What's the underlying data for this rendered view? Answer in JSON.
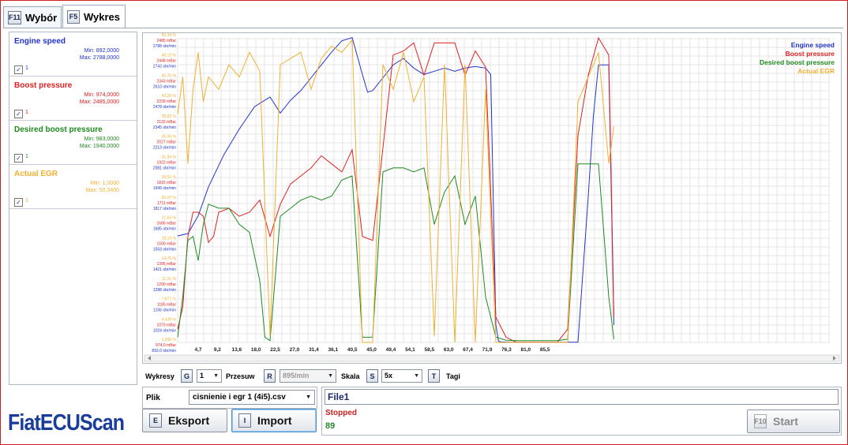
{
  "tabs": [
    {
      "key": "F11",
      "label": "Wybór"
    },
    {
      "key": "F5",
      "label": "Wykres"
    }
  ],
  "colors": {
    "engine": "#2233cc",
    "boost": "#e02020",
    "desired": "#1e8a1e",
    "egr": "#f0b030"
  },
  "legend": [
    {
      "name": "Engine speed",
      "min": "Min: 892,0000",
      "max": "Max: 2788,0000",
      "check": "✓",
      "value": "1"
    },
    {
      "name": "Boost pressure",
      "min": "Min: 974,0000",
      "max": "Max: 2485,0000",
      "check": "✓",
      "value": "1"
    },
    {
      "name": "Desired boost pressure",
      "min": "Min: 983,0000",
      "max": "Max: 1940,0000",
      "check": "✓",
      "value": "1"
    },
    {
      "name": "Actual EGR",
      "min": "Min: 1,0000",
      "max": "Max: 50,3400",
      "check": "✓",
      "value": "1"
    }
  ],
  "chart_data": {
    "type": "line",
    "x_ticks": [
      "4,7",
      "9,2",
      "13,6",
      "18,0",
      "22,5",
      "27,0",
      "31,4",
      "36,1",
      "40,5",
      "45,0",
      "49,4",
      "54,1",
      "58,5",
      "63,0",
      "67,4",
      "71,9",
      "76,3",
      "81,0",
      "85,5"
    ],
    "y_tick_labels": [
      [
        "50,34 %",
        "2485 mBar",
        "2788 obr/min"
      ],
      [
        "48,13 %",
        "2448 mBar",
        "2742 obr/min"
      ],
      [
        "45,70 %",
        "2343 mBar",
        "2610 obr/min"
      ],
      [
        "42,26 %",
        "2239 mBar",
        "2478 obr/min"
      ],
      [
        "38,82 %",
        "2132 mBar",
        "2345 obr/min"
      ],
      [
        "35,36 %",
        "2027 mBar",
        "2213 obr/min"
      ],
      [
        "31,94 %",
        "1922 mBar",
        "2081 obr/min"
      ],
      [
        "28,51 %",
        "1816 mBar",
        "1949 obr/min"
      ],
      [
        "25,07 %",
        "1711 mBar",
        "1817 obr/min"
      ],
      [
        "21,63 %",
        "1606 mBar",
        "1685 obr/min"
      ],
      [
        "18,19 %",
        "1500 mBar",
        "1553 obr/min"
      ],
      [
        "14,76 %",
        "1395 mBar",
        "1421 obr/min"
      ],
      [
        "11,31 %",
        "1290 mBar",
        "1288 obr/min"
      ],
      [
        "7,877 %",
        "1185 mBar",
        "1156 obr/min"
      ],
      [
        "4,439 %",
        "1079 mBar",
        "1024 obr/min"
      ],
      [
        "1,000 %",
        "974,0 mBar",
        "892,0 obr/min"
      ]
    ],
    "x_range": [
      0,
      100
    ],
    "series": [
      {
        "name": "Engine speed",
        "color_key": "engine",
        "x": [
          0,
          2,
          4,
          6,
          9,
          12,
          15,
          18,
          20,
          22,
          24,
          26,
          28,
          30,
          32,
          34,
          36,
          37,
          38,
          40,
          42,
          44,
          46,
          48,
          50,
          52,
          54,
          56,
          58,
          60,
          61,
          62,
          62.5,
          63,
          65,
          70,
          75,
          78,
          80,
          81,
          82,
          83,
          84,
          85
        ],
        "y": [
          1555,
          1570,
          1680,
          1860,
          2060,
          2220,
          2360,
          2420,
          2320,
          2400,
          2460,
          2540,
          2620,
          2700,
          2770,
          2790,
          2560,
          2450,
          2460,
          2540,
          2620,
          2660,
          2600,
          2560,
          2580,
          2600,
          2580,
          2600,
          2610,
          2600,
          2560,
          1000,
          900,
          895,
          893,
          893,
          893,
          893,
          1800,
          2300,
          2620,
          2620,
          2620,
          1000
        ]
      },
      {
        "name": "Boost pressure",
        "color_key": "boost",
        "x": [
          0,
          1,
          2,
          3,
          4,
          5,
          6,
          7,
          8,
          10,
          12,
          14,
          16,
          18,
          20,
          22,
          24,
          26,
          28,
          30,
          32,
          34,
          36,
          38,
          40,
          42,
          44,
          46,
          48,
          50,
          52,
          54,
          56,
          58,
          60,
          62,
          64,
          66,
          68,
          70,
          72,
          74,
          76,
          78,
          80,
          82,
          84,
          85
        ],
        "y": [
          1040,
          1150,
          1500,
          1620,
          1620,
          1600,
          1470,
          1500,
          1620,
          1640,
          1600,
          1620,
          1680,
          1500,
          1660,
          1760,
          1800,
          1840,
          1900,
          1860,
          1820,
          1930,
          1500,
          1480,
          1940,
          2400,
          2420,
          2460,
          2300,
          2460,
          2460,
          2460,
          2300,
          2420,
          2340,
          1100,
          1000,
          975,
          975,
          975,
          975,
          975,
          1040,
          2000,
          2300,
          2485,
          2400,
          1100
        ]
      },
      {
        "name": "Desired boost pressure",
        "color_key": "desired",
        "x": [
          0,
          1,
          2,
          3,
          4,
          5,
          6,
          8,
          10,
          12,
          14,
          16,
          17,
          18,
          20,
          22,
          24,
          26,
          28,
          30,
          32,
          34,
          36,
          38,
          40,
          42,
          44,
          46,
          48,
          50,
          52,
          54,
          56,
          58,
          60,
          62,
          64,
          66,
          68,
          70,
          72,
          74,
          76,
          78,
          80,
          82,
          84,
          85
        ],
        "y": [
          1000,
          1200,
          1480,
          1500,
          1380,
          1560,
          1660,
          1640,
          1640,
          1560,
          1520,
          1280,
          1000,
          983,
          1600,
          1640,
          1680,
          1700,
          1680,
          1700,
          1780,
          1800,
          1000,
          1000,
          1820,
          1840,
          1840,
          1820,
          1840,
          1560,
          1720,
          1800,
          1560,
          1700,
          1200,
          1000,
          985,
          983,
          983,
          983,
          983,
          983,
          990,
          1860,
          1860,
          1860,
          1200,
          990
        ]
      },
      {
        "name": "Actual EGR",
        "color_key": "egr",
        "x": [
          0,
          1,
          2,
          3,
          4,
          5,
          6,
          8,
          10,
          12,
          14,
          16,
          18,
          20,
          22,
          24,
          26,
          28,
          30,
          32,
          34,
          36,
          38,
          40,
          42,
          44,
          46,
          48,
          50,
          52,
          54,
          56,
          58,
          60,
          62,
          64,
          66,
          68,
          70,
          72,
          74,
          76,
          78,
          80,
          82,
          84,
          85
        ],
        "y": [
          38,
          44,
          30,
          42,
          48,
          40,
          44,
          42,
          46,
          44,
          48,
          45,
          2,
          46,
          47,
          48,
          42,
          47,
          49,
          48,
          50,
          1,
          1,
          46,
          42,
          48,
          40,
          44,
          2,
          46,
          1,
          46,
          1,
          42,
          1,
          1,
          1,
          1,
          1,
          1,
          1,
          1,
          40,
          44,
          48,
          30,
          36
        ]
      }
    ]
  },
  "series_legend": [
    "Engine speed",
    "Boost pressure",
    "Desired boost pressure",
    "Actual EGR"
  ],
  "controls": {
    "wykresy_label": "Wykresy",
    "wykresy_key": "G",
    "wykresy_value": "1",
    "przesuw_label": "Przesuw",
    "przesuw_key": "R",
    "przesuw_value": "895/min",
    "skala_label": "Skala",
    "skala_key": "S",
    "skala_value": "5x",
    "tagi_key": "T",
    "tagi_label": "Tagi"
  },
  "file": {
    "label": "Plik",
    "value": "cisnienie i egr 1 (4i5).csv"
  },
  "buttons": {
    "eksport_key": "E",
    "eksport_label": "Eksport",
    "import_key": "I",
    "import_label": "Import",
    "start_key": "F10",
    "start_label": "Start"
  },
  "logo": "FiatECUScan",
  "status": {
    "file_name": "File1",
    "state": "Stopped",
    "count": "89"
  }
}
